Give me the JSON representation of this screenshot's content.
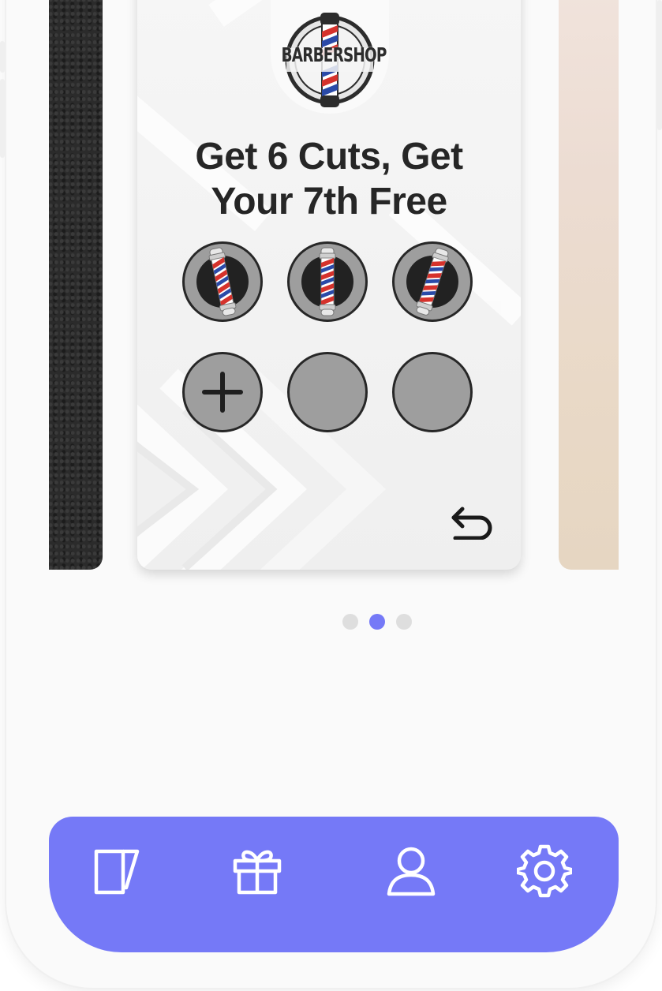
{
  "card": {
    "logo_text": "BARBERSHOP",
    "title_line1": "Get 6 Cuts, Get",
    "title_line2": "Your 7th Free",
    "stamps_total": 6,
    "stamps_filled": 3
  },
  "icons": {
    "add_stamp": "plus-icon",
    "flip": "undo-arrow-icon",
    "nav": [
      "cards-icon",
      "gift-icon",
      "user-icon",
      "gear-icon"
    ]
  },
  "pagination": {
    "count": 3,
    "active_index": 1
  },
  "colors": {
    "accent": "#7579f7",
    "dot_active": "#7579f7",
    "dot_inactive": "#dedede",
    "stamp_fill": "#9e9e9e",
    "stamp_border": "#272727",
    "title": "#262626"
  }
}
